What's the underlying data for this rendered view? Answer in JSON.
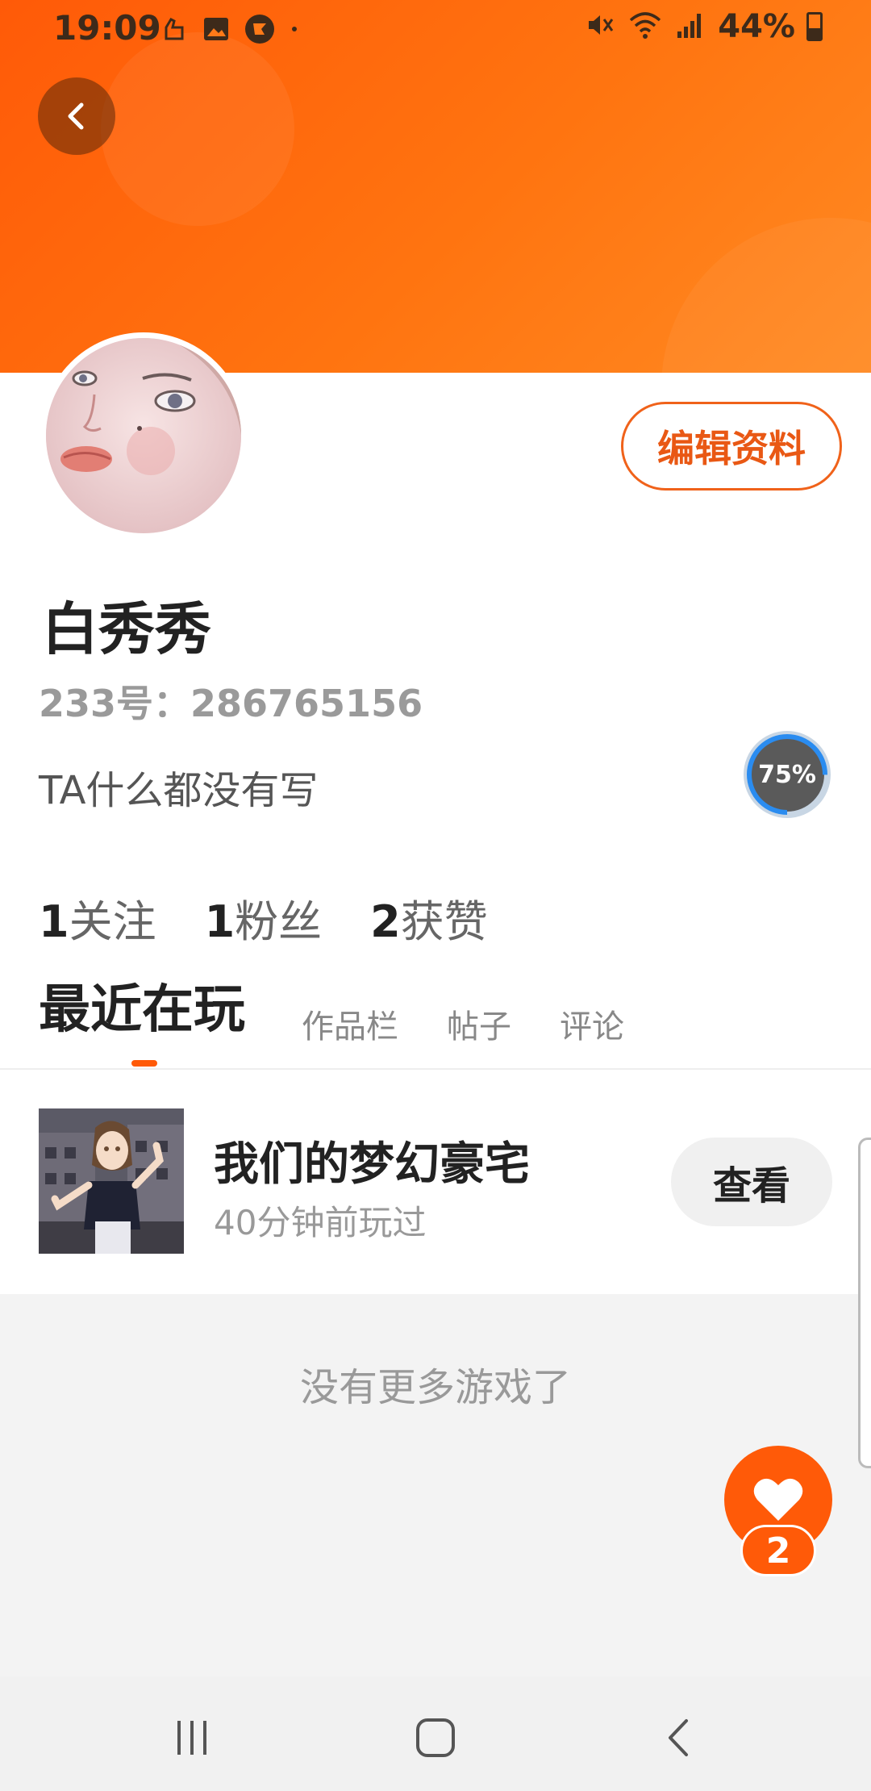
{
  "status_bar": {
    "time": "19:09",
    "battery": "44%",
    "icons": [
      "hand-icon",
      "image-icon",
      "app-icon",
      "dot",
      "mute-icon",
      "wifi-icon",
      "signal-icon",
      "battery-icon"
    ]
  },
  "header": {
    "back_icon": "chevron-left-icon",
    "accent_color": "#ff6a10"
  },
  "profile": {
    "edit_label": "编辑资料",
    "name": "白秀秀",
    "id_label": "233号：286765156",
    "bio": "TA什么都没有写",
    "progress_text": "75%",
    "progress_value": 0.75
  },
  "stats": [
    {
      "num": "1",
      "label": "关注"
    },
    {
      "num": "1",
      "label": "粉丝"
    },
    {
      "num": "2",
      "label": "获赞"
    }
  ],
  "tabs": [
    {
      "label": "最近在玩",
      "active": true
    },
    {
      "label": "作品栏",
      "active": false
    },
    {
      "label": "帖子",
      "active": false
    },
    {
      "label": "评论",
      "active": false
    }
  ],
  "games": [
    {
      "title": "我们的梦幻豪宅",
      "time": "40分钟前玩过",
      "button": "查看"
    }
  ],
  "footer": {
    "no_more": "没有更多游戏了",
    "like_count": "2"
  }
}
